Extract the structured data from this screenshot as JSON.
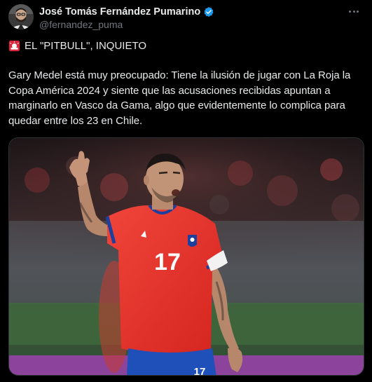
{
  "author": {
    "display_name": "José Tomás Fernández Pumarino",
    "handle": "@fernandez_puma",
    "verified_icon": "verified-badge-icon",
    "avatar_icon": "avatar-photo"
  },
  "tweet": {
    "headline_icon": "siren-emoji-icon",
    "headline": "EL \"PITBULL\", INQUIETO",
    "body": "Gary Medel está muy preocupado: Tiene la ilusión de jugar con La Roja la Copa América 2024 y siente que las acusaciones recibidas apuntan a marginarlo en Vasco da Gama, algo que evidentemente lo complica para quedar entre los 23 en Chile."
  },
  "media": {
    "jersey_number": "17",
    "jersey_number_back": "17",
    "description_icon": "football-player-photo"
  },
  "colors": {
    "background": "#000000",
    "text": "#e7e9ea",
    "secondary_text": "#71767b",
    "verified": "#1d9bf0",
    "jersey_red": "#e8302a",
    "shorts_blue": "#1f4fb8"
  },
  "menu_icon": "more-options-icon"
}
